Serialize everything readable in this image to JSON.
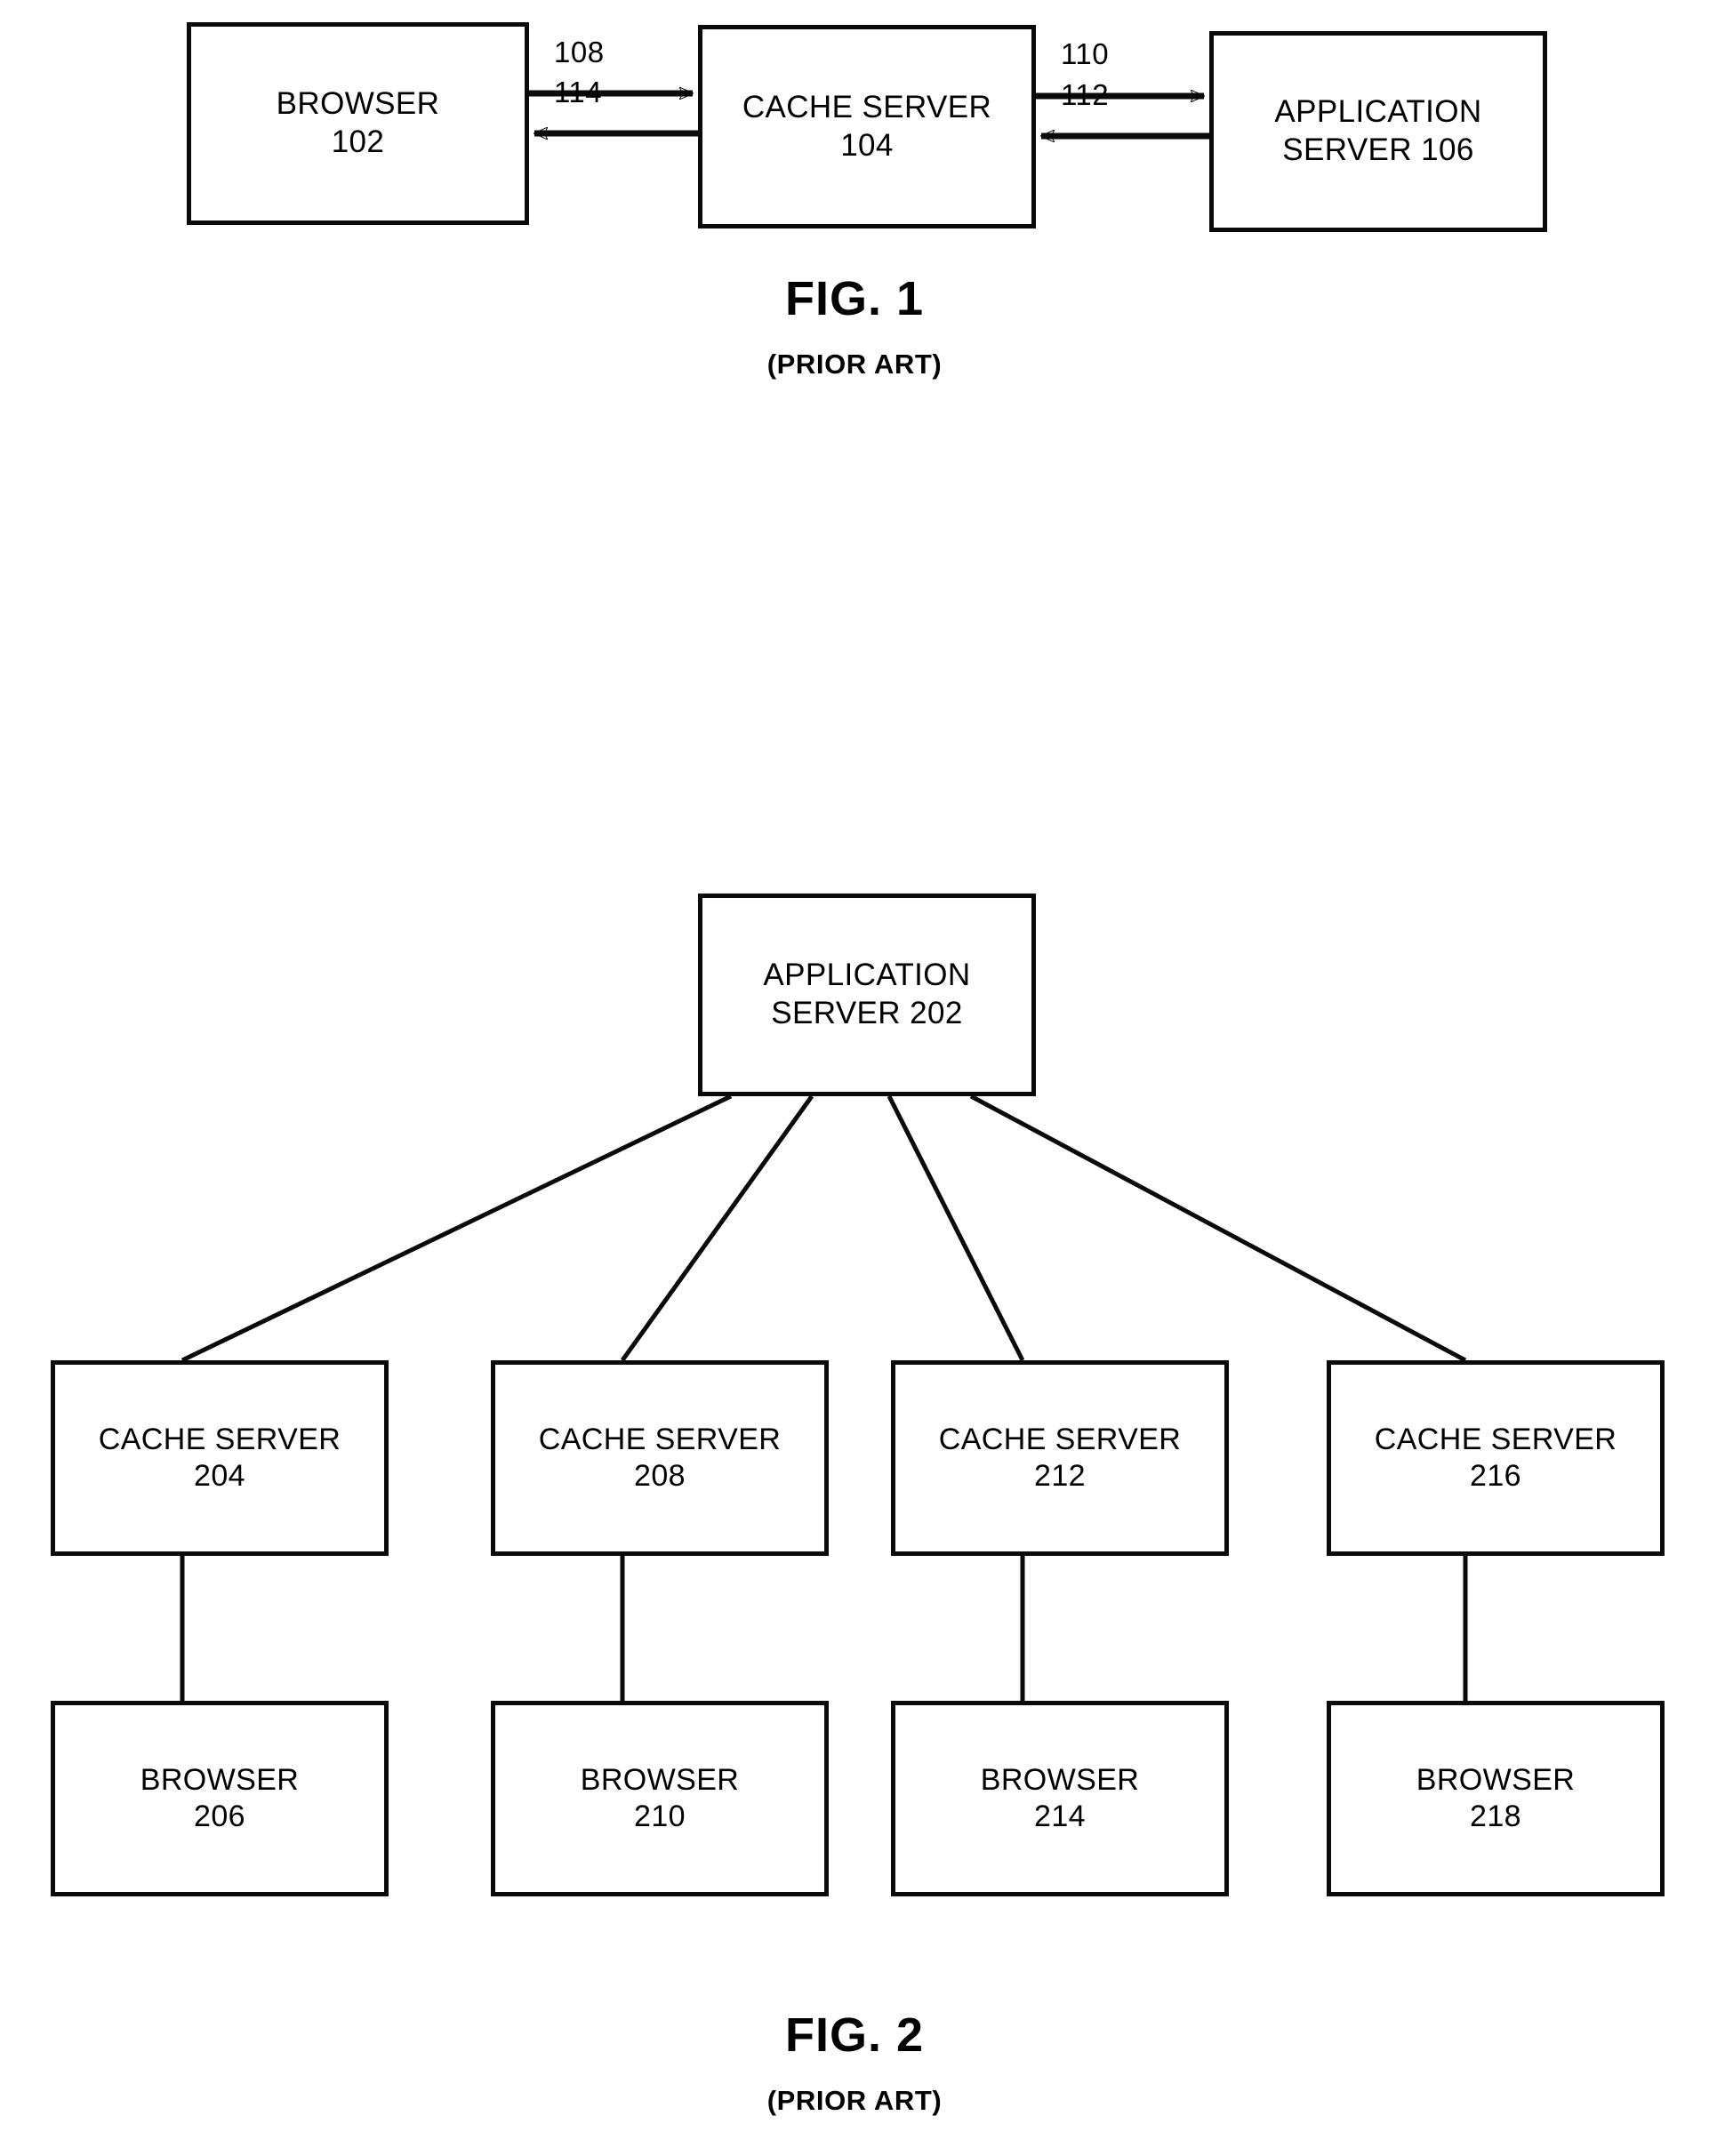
{
  "document": {
    "type": "patent-drawing-sheet",
    "background_color": "#ffffff",
    "ink_color": "#0a0a0a"
  },
  "figure1": {
    "caption": "FIG. 1",
    "subcaption": "(PRIOR ART)",
    "nodes": [
      {
        "id": "102",
        "line1": "BROWSER",
        "line2": "102"
      },
      {
        "id": "104",
        "line1": "CACHE SERVER",
        "line2": "104"
      },
      {
        "id": "106",
        "line1": "APPLICATION",
        "line2": "SERVER 106"
      }
    ],
    "arrows": [
      {
        "ref": "108",
        "from": "102",
        "to": "104",
        "direction": "right"
      },
      {
        "ref": "114",
        "from": "104",
        "to": "102",
        "direction": "left"
      },
      {
        "ref": "110",
        "from": "104",
        "to": "106",
        "direction": "right"
      },
      {
        "ref": "112",
        "from": "106",
        "to": "104",
        "direction": "left"
      }
    ]
  },
  "figure2": {
    "caption": "FIG. 2",
    "subcaption": "(PRIOR ART)",
    "root": {
      "id": "202",
      "line1": "APPLICATION",
      "line2": "SERVER 202"
    },
    "cache_servers": [
      {
        "id": "204",
        "line1": "CACHE SERVER",
        "line2": "204"
      },
      {
        "id": "208",
        "line1": "CACHE SERVER",
        "line2": "208"
      },
      {
        "id": "212",
        "line1": "CACHE SERVER",
        "line2": "212"
      },
      {
        "id": "216",
        "line1": "CACHE SERVER",
        "line2": "216"
      }
    ],
    "browsers": [
      {
        "id": "206",
        "line1": "BROWSER",
        "line2": "206"
      },
      {
        "id": "210",
        "line1": "BROWSER",
        "line2": "210"
      },
      {
        "id": "214",
        "line1": "BROWSER",
        "line2": "214"
      },
      {
        "id": "218",
        "line1": "BROWSER",
        "line2": "218"
      }
    ]
  }
}
